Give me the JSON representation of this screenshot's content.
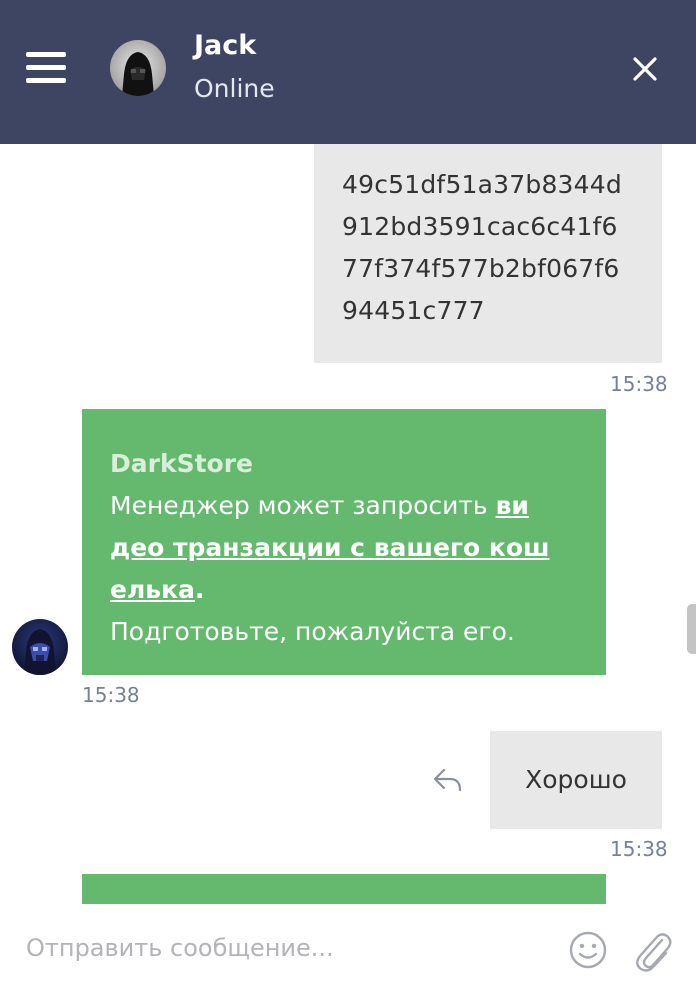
{
  "header": {
    "contact_name": "Jack",
    "contact_status": "Online",
    "menu_icon": "hamburger-menu-icon",
    "close_icon": "close-icon",
    "bg_color": "#3d4563"
  },
  "messages": [
    {
      "direction": "out",
      "lines": [
        "49c51df51a37b8344d",
        "912bd3591cac6c41f6",
        "77f374f577b2bf067f6",
        "94451c777"
      ],
      "time": "15:38"
    },
    {
      "direction": "in",
      "sender": "DarkStore",
      "line1_text": "Менеджер может запросить ",
      "line1_link": "ви",
      "line2_link": "део транзакции с вашего кош",
      "line3_link": "елька",
      "line3_tail": ".",
      "line4_text": "Подготовьте, пожалуйста его.",
      "time": "15:38",
      "bg_color": "#65b96e"
    },
    {
      "direction": "out",
      "text": "Хорошо",
      "time": "15:38",
      "reply_icon": "reply-arrow-icon"
    }
  ],
  "composer": {
    "placeholder": "Отправить сообщение...",
    "emoji_icon": "emoji-icon",
    "attach_icon": "paperclip-icon"
  },
  "colors": {
    "bubble_out": "#e8e8e8",
    "bubble_in": "#65b96e",
    "time": "#76809a"
  }
}
